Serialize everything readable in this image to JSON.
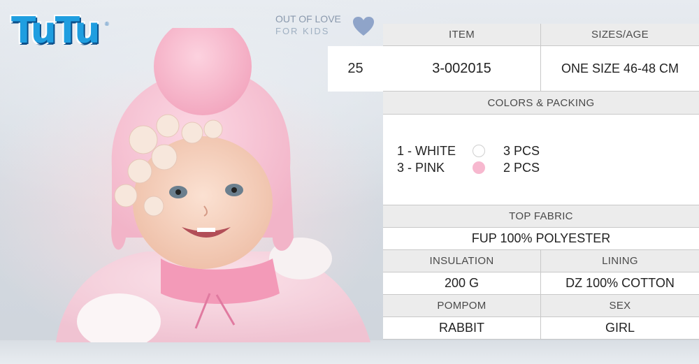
{
  "brand": {
    "logo": "TuTu",
    "slogan_line1": "OUT OF LOVE",
    "slogan_line2": "FOR KIDS"
  },
  "product": {
    "number": "25",
    "item_header": "ITEM",
    "item_value": "3-002015",
    "sizes_header": "SIZES/AGE",
    "sizes_value": "ONE SIZE 46-48 CM",
    "colors_header": "COLORS & PACKING",
    "colors": [
      {
        "name": "1 - WHITE",
        "swatch": "#ffffff",
        "pcs": "3 PCS"
      },
      {
        "name": "3 - PINK",
        "swatch": "#f7b8cf",
        "pcs": "2 PCS"
      }
    ],
    "top_fabric_header": "TOP FABRIC",
    "top_fabric_value": "FUP 100% POLYESTER",
    "insulation_header": "INSULATION",
    "insulation_value": "200 G",
    "lining_header": "LINING",
    "lining_value": "DZ 100% COTTON",
    "pompom_header": "POMPOM",
    "pompom_value": "RABBIT",
    "sex_header": "SEX",
    "sex_value": "GIRL"
  },
  "colors_theme": {
    "header_bg": "#ececec",
    "value_bg": "#ffffff",
    "logo_blue": "#1f9ee0",
    "heart": "#8fa4c9"
  }
}
